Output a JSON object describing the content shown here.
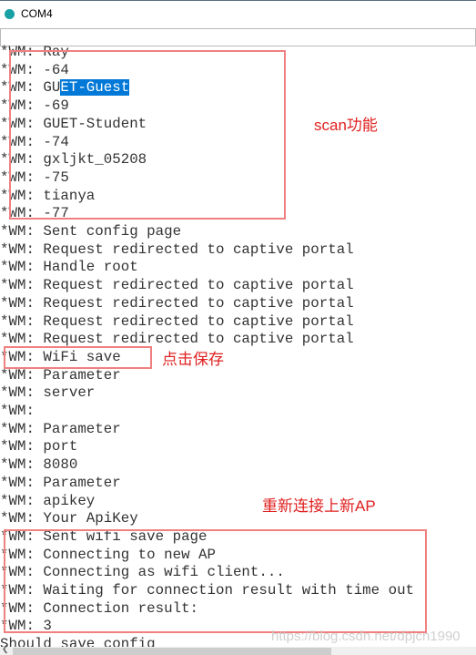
{
  "window": {
    "title": "COM4",
    "icon": "arduino-logo-icon"
  },
  "serial_input": {
    "value": ""
  },
  "lines": [
    "*WM: Ray",
    "*WM: -64",
    "*WM: GUET-Guest",
    "*WM: -69",
    "*WM: GUET-Student",
    "*WM: -74",
    "*WM: gxljkt_05208",
    "*WM: -75",
    "*WM: tianya",
    "*WM: -77",
    "*WM: Sent config page",
    "*WM: Request redirected to captive portal",
    "*WM: Handle root",
    "*WM: Request redirected to captive portal",
    "*WM: Request redirected to captive portal",
    "*WM: Request redirected to captive portal",
    "*WM: Request redirected to captive portal",
    "*WM: WiFi save",
    "*WM: Parameter",
    "*WM: server",
    "*WM:",
    "*WM: Parameter",
    "*WM: port",
    "*WM: 8080",
    "*WM: Parameter",
    "*WM: apikey",
    "*WM: Your ApiKey",
    "*WM: Sent wifi save page",
    "*WM: Connecting to new AP",
    "*WM: Connecting as wifi client...",
    "*WM: Waiting for connection result with time out",
    "*WM: Connection result:",
    "*WM: 3",
    "Should save config"
  ],
  "selection": {
    "line": 2,
    "before": "*WM: GU",
    "selected": "ET-Guest"
  },
  "annotations": {
    "scan": "scan功能",
    "save": "点击保存",
    "reconnect": "重新连接上新AP"
  },
  "annotation_color": "#e02020",
  "watermark": "https://blog.csdn.net/dpjcn1990"
}
